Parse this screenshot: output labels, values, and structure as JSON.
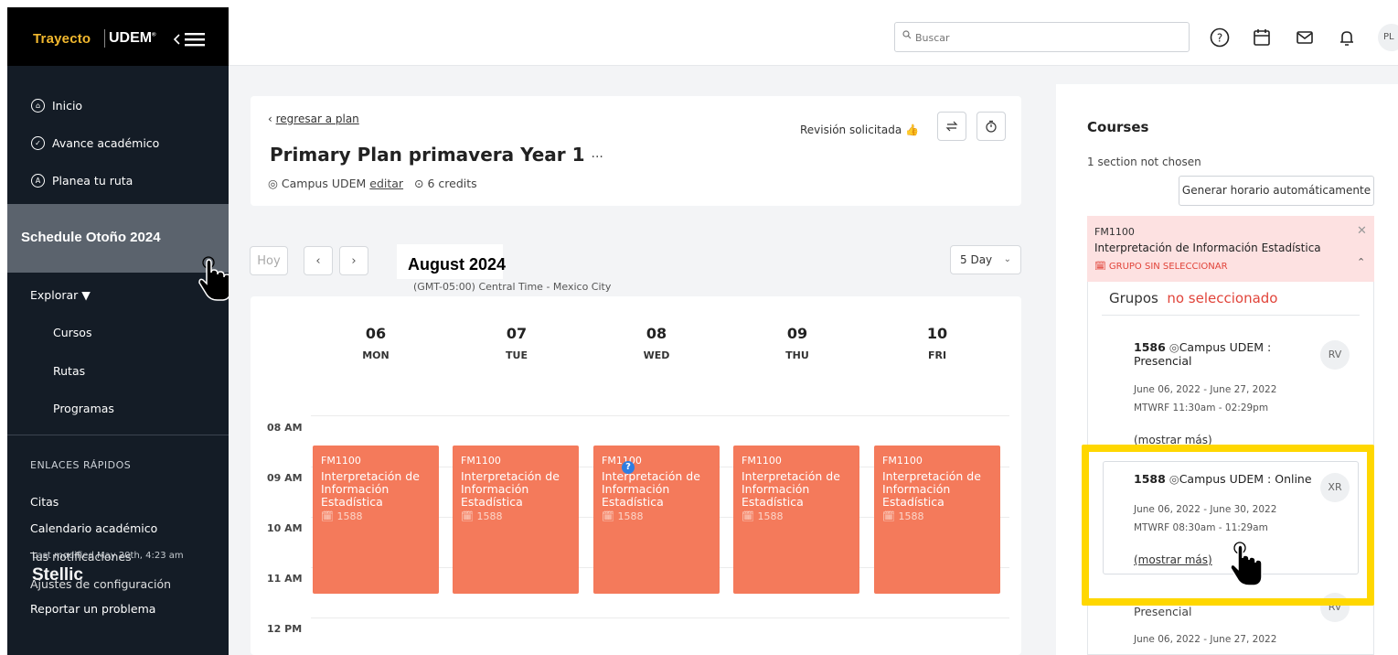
{
  "brand": {
    "trayecto": "Trayecto",
    "udem": "UDEM"
  },
  "sidebar": {
    "nav": [
      {
        "label": "Inicio",
        "icon": "home-icon"
      },
      {
        "label": "Avance académico",
        "icon": "check-circle-icon"
      },
      {
        "label": "Planea tu ruta",
        "icon": "route-icon"
      }
    ],
    "active_item": "Schedule Otoño 2024",
    "explorar": "Explorar ▼",
    "sub_items": [
      "Cursos",
      "Rutas",
      "Programas"
    ],
    "quick_links_title": "ENLACES RÁPIDOS",
    "quick_links": [
      "Citas",
      "Calendario académico",
      "Tus notificaciones",
      "Ajustes de configuración",
      "Reportar un problema"
    ],
    "last_modified": "Last modified May 20th, 4:23 am",
    "stellic": "Stellic"
  },
  "topbar": {
    "search_placeholder": "Buscar",
    "avatar": "PL"
  },
  "plan": {
    "back_link": "regresar a plan",
    "title": "Primary Plan primavera Year 1",
    "title_menu": "···",
    "campus": "Campus UDEM",
    "edit": "editar",
    "credits": "6 credits",
    "revision": "Revisión solicitada"
  },
  "calendar": {
    "today": "Hoy",
    "month": "August 2024",
    "timezone": "(GMT-05:00) Central Time - Mexico City",
    "view": "5 Day",
    "days": [
      {
        "num": "06",
        "name": "MON"
      },
      {
        "num": "07",
        "name": "TUE"
      },
      {
        "num": "08",
        "name": "WED"
      },
      {
        "num": "09",
        "name": "THU"
      },
      {
        "num": "10",
        "name": "FRI"
      }
    ],
    "hours": [
      "08 AM",
      "09 AM",
      "10 AM",
      "11 AM",
      "12 PM"
    ],
    "event": {
      "code": "FM1100",
      "title": "Interpretación de Información Estadística",
      "section": "1588"
    },
    "question_badge": "?"
  },
  "courses": {
    "title": "Courses",
    "subtitle": "1 section not chosen",
    "auto_button": "Generar horario automáticamente",
    "course": {
      "code": "FM1100",
      "title": "Interpretación de Información Estadística",
      "flag": "GRUPO SIN SELECCIONAR"
    },
    "grupos_label": "Grupos",
    "grupos_status": "no seleccionado",
    "sections": [
      {
        "num": "1586",
        "location": "Campus UDEM : Presencial",
        "dates": "June 06, 2022 - June 27, 2022",
        "times": "MTWRF  11:30am - 02:29pm",
        "more": "(mostrar más)",
        "avatar": "RV"
      },
      {
        "num": "1588",
        "location": "Campus UDEM : Online",
        "dates": "June 06, 2022 - June 30, 2022",
        "times": "MTWRF  08:30am - 11:29am",
        "more": "(mostrar más)",
        "avatar": "XR"
      },
      {
        "location_tail": "Presencial",
        "dates": "June 06, 2022 - June 27, 2022",
        "avatar": "RV"
      }
    ]
  }
}
